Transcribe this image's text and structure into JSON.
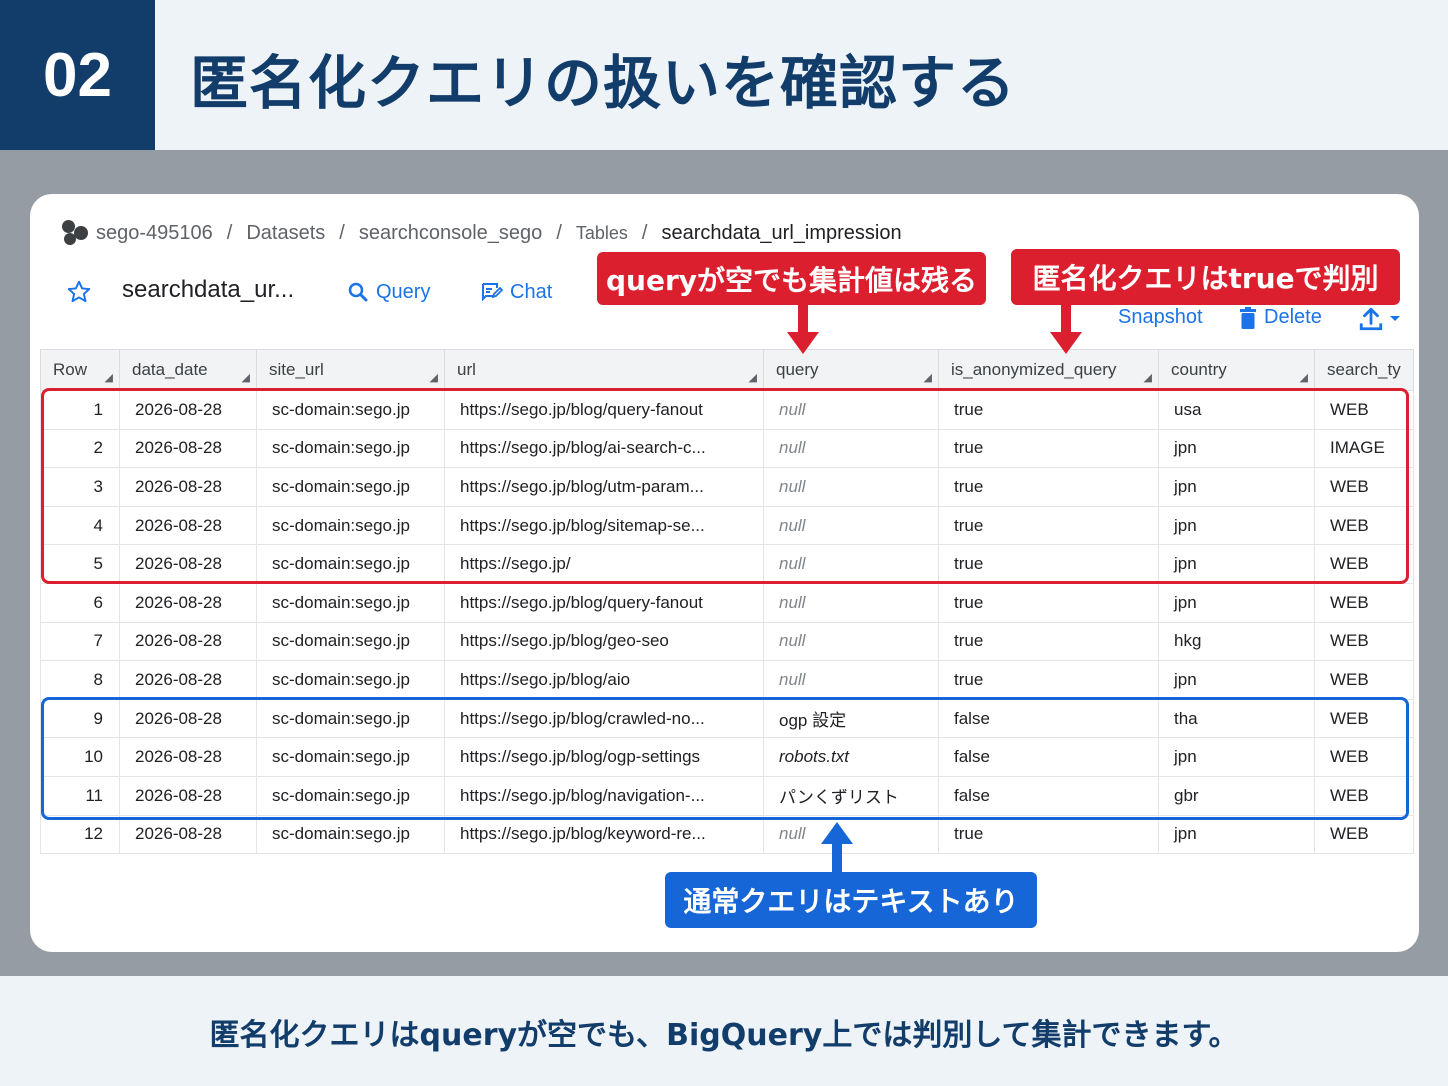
{
  "slide": {
    "number": "02",
    "title": "匿名化クエリの扱いを確認する",
    "footer": "匿名化クエリはqueryが空でも、BigQuery上では判別して集計できます。"
  },
  "breadcrumb": {
    "project": "sego-495106",
    "datasets": "Datasets",
    "dataset": "searchconsole_sego",
    "tables": "Tables",
    "table": "searchdata_url_impression",
    "separator": "/"
  },
  "toolbar": {
    "table_name": "searchdata_ur...",
    "query_label": "Query",
    "chat_label": "Chat",
    "snapshot_label": "Snapshot",
    "delete_label": "Delete"
  },
  "callouts": {
    "query_empty": "queryが空でも集計値は残る",
    "anonymized_true": "匿名化クエリはtrueで判別",
    "normal_query": "通常クエリはテキストあり"
  },
  "table": {
    "columns": [
      "Row",
      "data_date",
      "site_url",
      "url",
      "query",
      "is_anonymized_query",
      "country",
      "search_ty"
    ],
    "rows": [
      [
        "1",
        "2026-08-28",
        "sc-domain:sego.jp",
        "https://sego.jp/blog/query-fanout",
        "null",
        "true",
        "usa",
        "WEB"
      ],
      [
        "2",
        "2026-08-28",
        "sc-domain:sego.jp",
        "https://sego.jp/blog/ai-search-c...",
        "null",
        "true",
        "jpn",
        "IMAGE"
      ],
      [
        "3",
        "2026-08-28",
        "sc-domain:sego.jp",
        "https://sego.jp/blog/utm-param...",
        "null",
        "true",
        "jpn",
        "WEB"
      ],
      [
        "4",
        "2026-08-28",
        "sc-domain:sego.jp",
        "https://sego.jp/blog/sitemap-se...",
        "null",
        "true",
        "jpn",
        "WEB"
      ],
      [
        "5",
        "2026-08-28",
        "sc-domain:sego.jp",
        "https://sego.jp/",
        "null",
        "true",
        "jpn",
        "WEB"
      ],
      [
        "6",
        "2026-08-28",
        "sc-domain:sego.jp",
        "https://sego.jp/blog/query-fanout",
        "null",
        "true",
        "jpn",
        "WEB"
      ],
      [
        "7",
        "2026-08-28",
        "sc-domain:sego.jp",
        "https://sego.jp/blog/geo-seo",
        "null",
        "true",
        "hkg",
        "WEB"
      ],
      [
        "8",
        "2026-08-28",
        "sc-domain:sego.jp",
        "https://sego.jp/blog/aio",
        "null",
        "true",
        "jpn",
        "WEB"
      ],
      [
        "9",
        "2026-08-28",
        "sc-domain:sego.jp",
        "https://sego.jp/blog/crawled-no...",
        "ogp 設定",
        "false",
        "tha",
        "WEB"
      ],
      [
        "10",
        "2026-08-28",
        "sc-domain:sego.jp",
        "https://sego.jp/blog/ogp-settings",
        "robots.txt",
        "false",
        "jpn",
        "WEB"
      ],
      [
        "11",
        "2026-08-28",
        "sc-domain:sego.jp",
        "https://sego.jp/blog/navigation-...",
        "パンくずリスト",
        "false",
        "gbr",
        "WEB"
      ],
      [
        "12",
        "2026-08-28",
        "sc-domain:sego.jp",
        "https://sego.jp/blog/keyword-re...",
        "null",
        "true",
        "jpn",
        "WEB"
      ]
    ]
  },
  "colors": {
    "navy": "#123d6b",
    "highlight_red": "#dc1f2e",
    "highlight_blue": "#1666d8",
    "link_blue": "#1a73e8"
  },
  "icons": [
    "project-icon",
    "star-icon",
    "search-icon",
    "chat-icon",
    "delete-icon",
    "export-icon",
    "chevron-down-icon",
    "resize-icon"
  ]
}
